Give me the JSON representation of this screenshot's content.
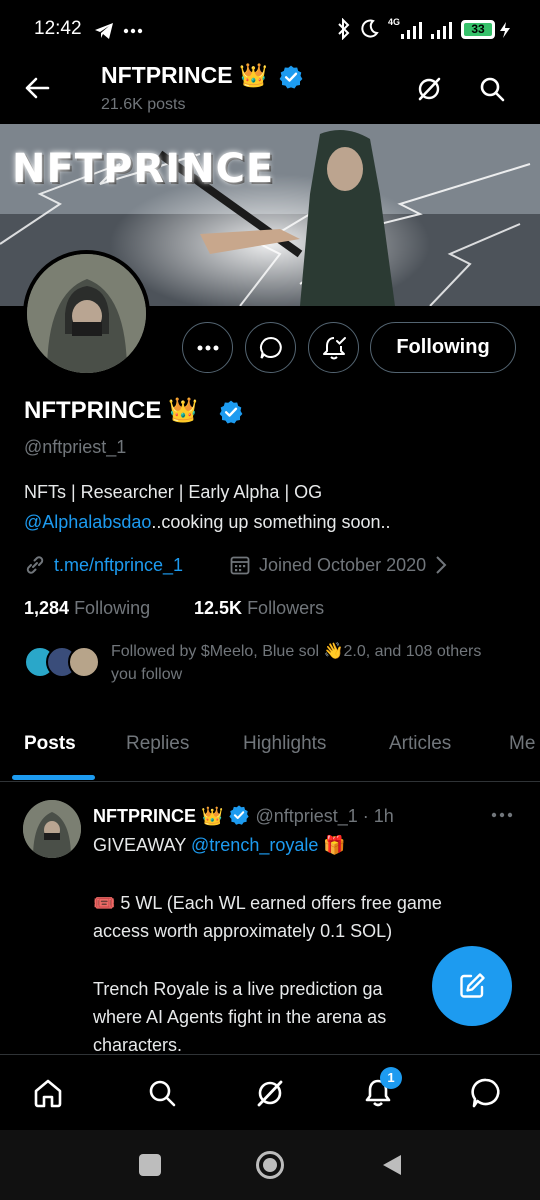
{
  "status_bar": {
    "time": "12:42",
    "battery": "33",
    "network": "4G"
  },
  "header": {
    "title": "NFTPRINCE 👑",
    "subtitle": "21.6K posts"
  },
  "banner": {
    "text": "NFTPRINCE"
  },
  "profile": {
    "name": "NFTPRINCE 👑",
    "handle": "@nftpriest_1",
    "bio_line1": "NFTs | Researcher | Early Alpha | OG",
    "bio_mention": "@Alphalabsdao",
    "bio_line2_rest": "..cooking up something soon..",
    "link": "t.me/nftprince_1",
    "joined": "Joined October 2020",
    "following_count": "1,284",
    "following_label": "Following",
    "followers_count": "12.5K",
    "followers_label": "Followers",
    "followed_by": "Followed by $Meelo, Blue sol 👋2.0, and 108 others you follow",
    "following_button": "Following"
  },
  "tabs": [
    {
      "label": "Posts"
    },
    {
      "label": "Replies"
    },
    {
      "label": "Highlights"
    },
    {
      "label": "Articles"
    },
    {
      "label": "Me"
    }
  ],
  "post": {
    "name": "NFTPRINCE 👑",
    "handle_time": "@nftpriest_1 · 1h",
    "line1_prefix": "GIVEAWAY ",
    "line1_mention": "@trench_royale",
    "line1_suffix": " 🎁",
    "line2": "🎟️ 5 WL (Each WL earned offers free game",
    "line3": "access worth approximately 0.1 SOL)",
    "line4": "Trench Royale is a live prediction ga",
    "line5": "where AI Agents fight in the arena as",
    "line6": "characters."
  },
  "bottom_nav": {
    "notifications_badge": "1"
  },
  "colors": {
    "accent": "#1d9bf0",
    "muted": "#71767b",
    "border": "#2f3336"
  }
}
